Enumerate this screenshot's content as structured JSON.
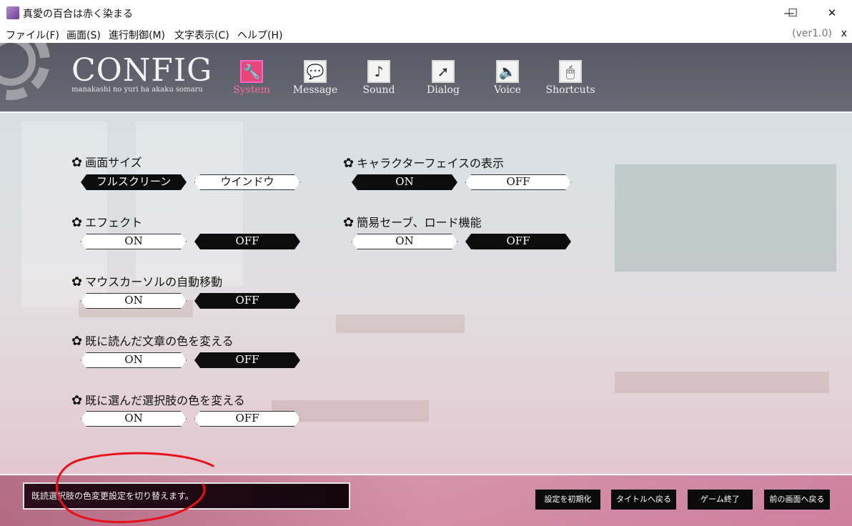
{
  "window": {
    "title": "真愛の百合は赤く染まる",
    "minimize": "—",
    "maximize": "☐",
    "close": "✕"
  },
  "menu": {
    "items": [
      "ファイル(F)",
      "画面(S)",
      "進行制御(M)",
      "文字表示(C)",
      "ヘルプ(H)"
    ],
    "version": "(ver1.0)",
    "close": "x"
  },
  "header": {
    "title": "CONFIG",
    "subtitle": "manakashi no yuri ha akaku somaru",
    "tabs": [
      {
        "label": "System",
        "icon": "wrench-icon",
        "glyph": "🔧",
        "active": true
      },
      {
        "label": "Message",
        "icon": "speech-bubble-icon",
        "glyph": "💬",
        "active": false
      },
      {
        "label": "Sound",
        "icon": "music-note-icon",
        "glyph": "♪",
        "active": false
      },
      {
        "label": "Dialog",
        "icon": "cursor-arrow-icon",
        "glyph": "➚",
        "active": false
      },
      {
        "label": "Voice",
        "icon": "speaker-icon",
        "glyph": "🔈",
        "active": false
      },
      {
        "label": "Shortcuts",
        "icon": "mouse-icon",
        "glyph": "🖱",
        "active": false
      }
    ]
  },
  "settings": {
    "screen_size": {
      "title": "画面サイズ",
      "options": [
        "フルスクリーン",
        "ウインドウ"
      ],
      "selected": "フルスクリーン"
    },
    "effect": {
      "title": "エフェクト",
      "options": [
        "ON",
        "OFF"
      ],
      "selected": "OFF"
    },
    "mouse_auto_move": {
      "title": "マウスカーソルの自動移動",
      "options": [
        "ON",
        "OFF"
      ],
      "selected": "OFF"
    },
    "read_text_color": {
      "title": "既に読んだ文章の色を変える",
      "options": [
        "ON",
        "OFF"
      ],
      "selected": "OFF"
    },
    "chosen_option_color": {
      "title": "既に選んだ選択肢の色を変える",
      "options": [
        "ON",
        "OFF"
      ],
      "selected": "none"
    },
    "character_face": {
      "title": "キャラクターフェイスの表示",
      "options": [
        "ON",
        "OFF"
      ],
      "selected": "ON"
    },
    "quick_save": {
      "title": "簡易セーブ、ロード機能",
      "options": [
        "ON",
        "OFF"
      ],
      "selected": "OFF"
    }
  },
  "footer": {
    "message": "既読選択肢の色変更設定を切り替えます。",
    "buttons": [
      "設定を初期化",
      "タイトルへ戻る",
      "ゲーム終了",
      "前の画面へ戻る"
    ]
  },
  "colors": {
    "active_tab": "#e8457a",
    "selected_option": "#0c0c0c",
    "annotation": "#e8101a"
  }
}
